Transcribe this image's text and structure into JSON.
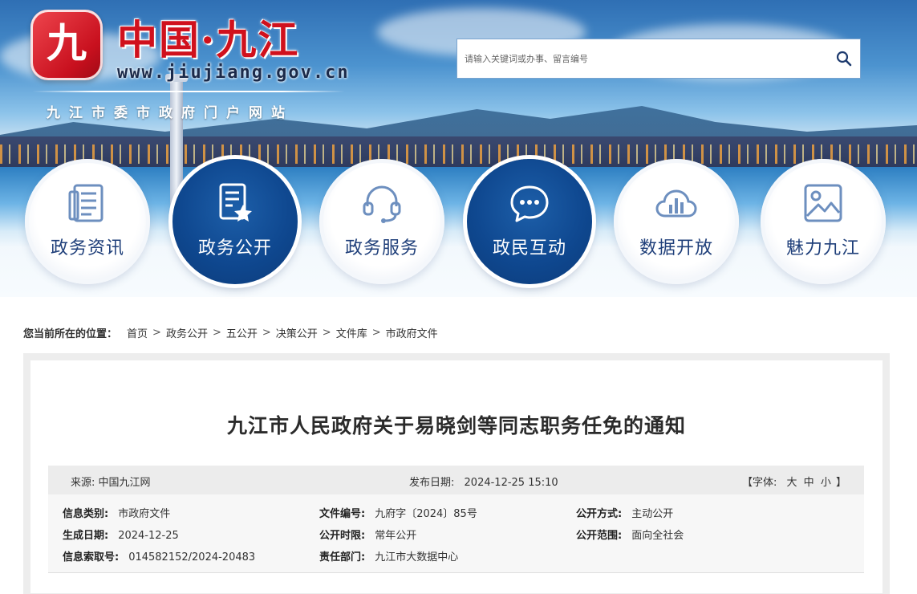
{
  "site": {
    "logo_char": "九",
    "title": "中国·九江",
    "url": "www.jiujiang.gov.cn",
    "subtitle": "九江市委市政府门户网站"
  },
  "search": {
    "placeholder": "请输入关键词或办事、留言编号",
    "icon": "search-icon"
  },
  "nav": {
    "items": [
      {
        "label": "政务资讯",
        "icon": "news-document-icon",
        "active": false
      },
      {
        "label": "政务公开",
        "icon": "document-star-icon",
        "active": true
      },
      {
        "label": "政务服务",
        "icon": "headset-icon",
        "active": false
      },
      {
        "label": "政民互动",
        "icon": "chat-bubble-icon",
        "active": true
      },
      {
        "label": "数据开放",
        "icon": "cloud-chart-icon",
        "active": false
      },
      {
        "label": "魅力九江",
        "icon": "picture-icon",
        "active": false
      }
    ]
  },
  "breadcrumb": {
    "label": "您当前所在的位置：",
    "items": [
      "首页",
      "政务公开",
      "五公开",
      "决策公开",
      "文件库",
      "市政府文件"
    ],
    "separator": ">"
  },
  "article": {
    "title": "九江市人民政府关于易晓剑等同志职务任免的通知",
    "source_label": "来源:",
    "source_value": "中国九江网",
    "date_label": "发布日期:",
    "date_value": "2024-12-25 15:10",
    "font_label": "【字体:",
    "font_large": "大",
    "font_medium": "中",
    "font_small": "小",
    "font_close": "】"
  },
  "info": {
    "category_label": "信息类别:",
    "category_value": "市政府文件",
    "doc_no_label": "文件编号:",
    "doc_no_value": "九府字〔2024〕85号",
    "disclosure_mode_label": "公开方式:",
    "disclosure_mode_value": "主动公开",
    "created_label": "生成日期:",
    "created_value": "2024-12-25",
    "period_label": "公开时限:",
    "period_value": "常年公开",
    "scope_label": "公开范围:",
    "scope_value": "面向全社会",
    "index_label": "信息索取号:",
    "index_value": "014582152/2024-20483",
    "dept_label": "责任部门:",
    "dept_value": "九江市大数据中心"
  },
  "colors": {
    "brand_red": "#d0111d",
    "nav_dark": "#0f4890",
    "nav_text_light": "#1f3f7a"
  }
}
